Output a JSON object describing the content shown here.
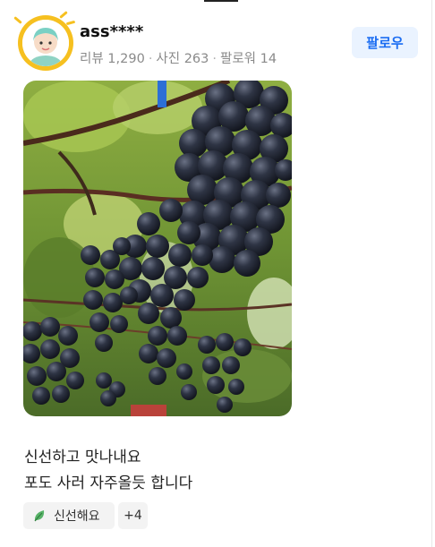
{
  "reviewer": {
    "nickname": "ass****",
    "stats": {
      "reviews_label": "리뷰 1,290",
      "photos_label": "사진 263",
      "followers_label": "팔로워 14"
    },
    "follow_label": "팔로우",
    "avatar_icon": "character-avatar-icon"
  },
  "review": {
    "lines": [
      "신선하고 맛나내요",
      "포도 사러 자주올듯 합니다"
    ],
    "tags": [
      {
        "label": "신선해요",
        "icon": "leaf-icon"
      },
      {
        "label": "+4"
      }
    ]
  },
  "colors": {
    "accent": "#1b6df2",
    "follow_bg": "#eaf3ff",
    "avatar_ring": "#f6c020",
    "muted_text": "#8a8a8a"
  }
}
